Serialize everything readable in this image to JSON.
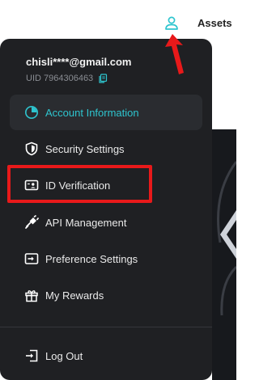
{
  "header": {
    "assets_label": "Assets",
    "user_icon": "user-icon"
  },
  "account": {
    "email": "chisli****@gmail.com",
    "uid": "UID 7964306463",
    "copy_icon": "copy-icon"
  },
  "menu": {
    "items": [
      {
        "label": "Account Information",
        "icon": "pie-chart-icon",
        "active": true
      },
      {
        "label": "Security Settings",
        "icon": "shield-icon",
        "active": false
      },
      {
        "label": "ID Verification",
        "icon": "id-card-icon",
        "active": false
      },
      {
        "label": "API Management",
        "icon": "plug-icon",
        "active": false
      },
      {
        "label": "Preference Settings",
        "icon": "preference-icon",
        "active": false
      },
      {
        "label": "My Rewards",
        "icon": "gift-icon",
        "active": false
      }
    ],
    "logout_label": "Log Out",
    "logout_icon": "logout-icon"
  },
  "colors": {
    "accent": "#2ec5cf",
    "panel_bg": "#1f2023",
    "annotation_red": "#e8191a"
  }
}
